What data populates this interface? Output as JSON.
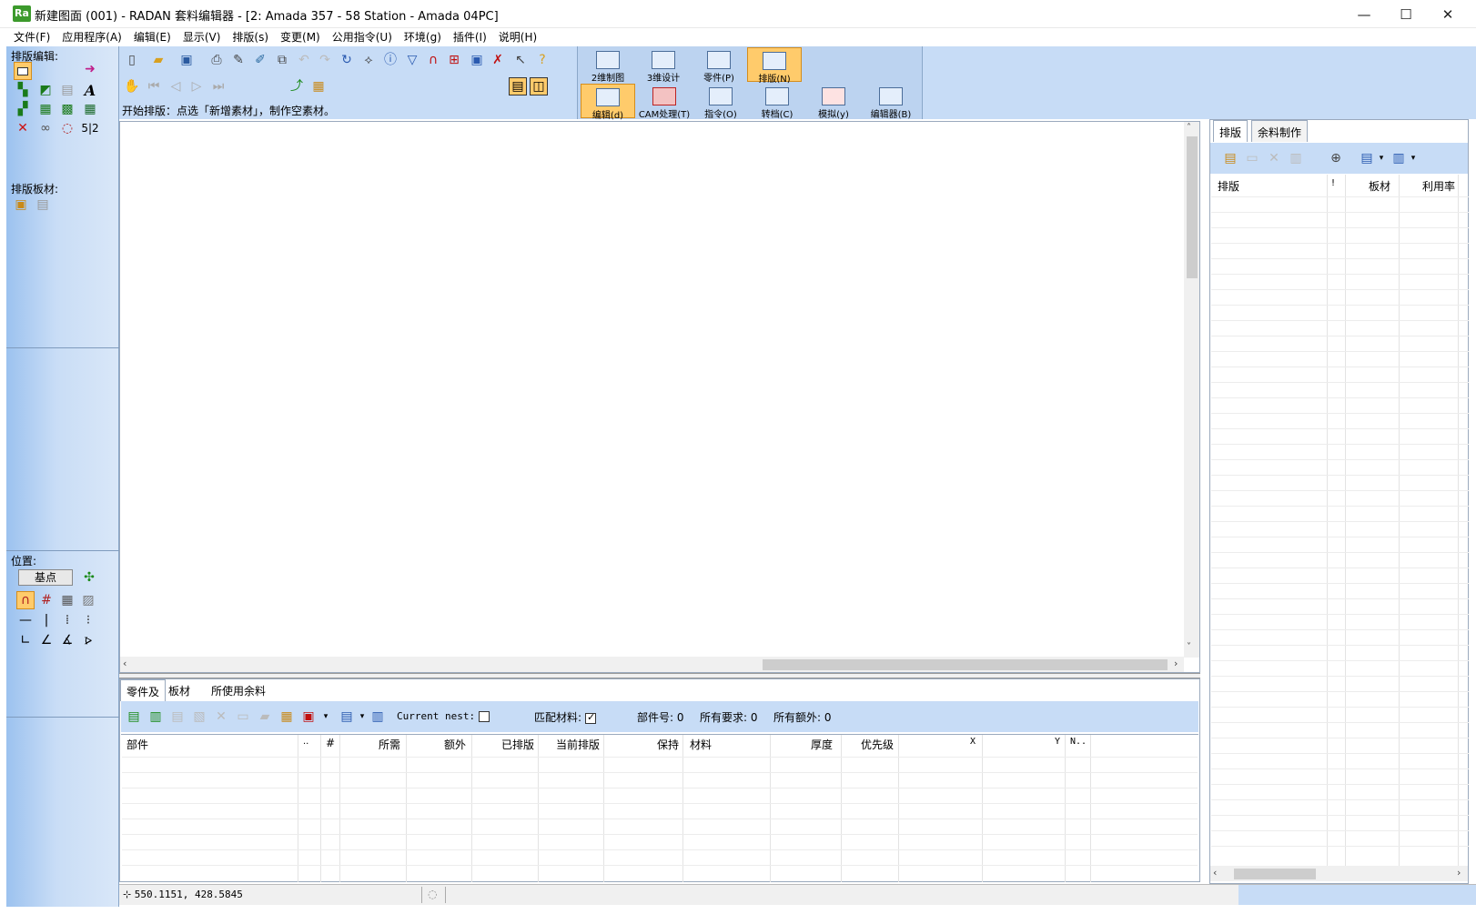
{
  "window": {
    "app_icon_label": "Ra",
    "title": "新建图面 (001) - RADAN 套料编辑器 - [2: Amada 357 - 58 Station - Amada 04PC]",
    "minimize": "—",
    "maximize": "☐",
    "close": "✕"
  },
  "menu": [
    "文件(F)",
    "应用程序(A)",
    "编辑(E)",
    "显示(V)",
    "排版(s)",
    "变更(M)",
    "公用指令(U)",
    "环境(g)",
    "插件(I)",
    "说明(H)"
  ],
  "left_panel": {
    "nest_edit_label": "排版编辑:",
    "nest_sheet_label": "排版板材:",
    "position_label": "位置:",
    "base_point_button": "基点",
    "fraction_label": "5|2"
  },
  "mode_bar": {
    "top": [
      {
        "label": "2维制图"
      },
      {
        "label": "3维设计"
      },
      {
        "label": "零件(P)"
      },
      {
        "label": "排版(N)",
        "active": true
      }
    ],
    "bottom": [
      {
        "label": "编辑(d)",
        "active": true
      },
      {
        "label": "CAM处理(T)"
      },
      {
        "label": "指令(O)"
      },
      {
        "label": "转档(C)"
      },
      {
        "label": "模拟(y)"
      },
      {
        "label": "编辑器(B)"
      }
    ]
  },
  "status_message": "开始排版：点选「新增素材」，制作空素材。",
  "bottom_panel": {
    "tabs": [
      "零件及",
      "板材",
      "所使用余料"
    ],
    "current_nest_label": "Current nest:",
    "match_material_label": "匹配材料:",
    "part_no": "部件号: 0",
    "total_required": "所有要求: 0",
    "total_extra": "所有额外: 0",
    "columns": [
      "部件",
      "..",
      "#",
      "所需",
      "额外",
      "已排版",
      "当前排版",
      "保持",
      "材料",
      "厚度",
      "优先级",
      "X",
      "Y",
      "N.."
    ]
  },
  "right_panel": {
    "tabs": [
      "排版",
      "余料制作"
    ],
    "columns": [
      "排版",
      "!",
      "板材",
      "利用率"
    ]
  },
  "statusbar": {
    "coords": "550.1151,  428.5845"
  },
  "colors": {
    "panel_blue": "#c7dcf6",
    "active_orange": "#ffcb6b"
  }
}
